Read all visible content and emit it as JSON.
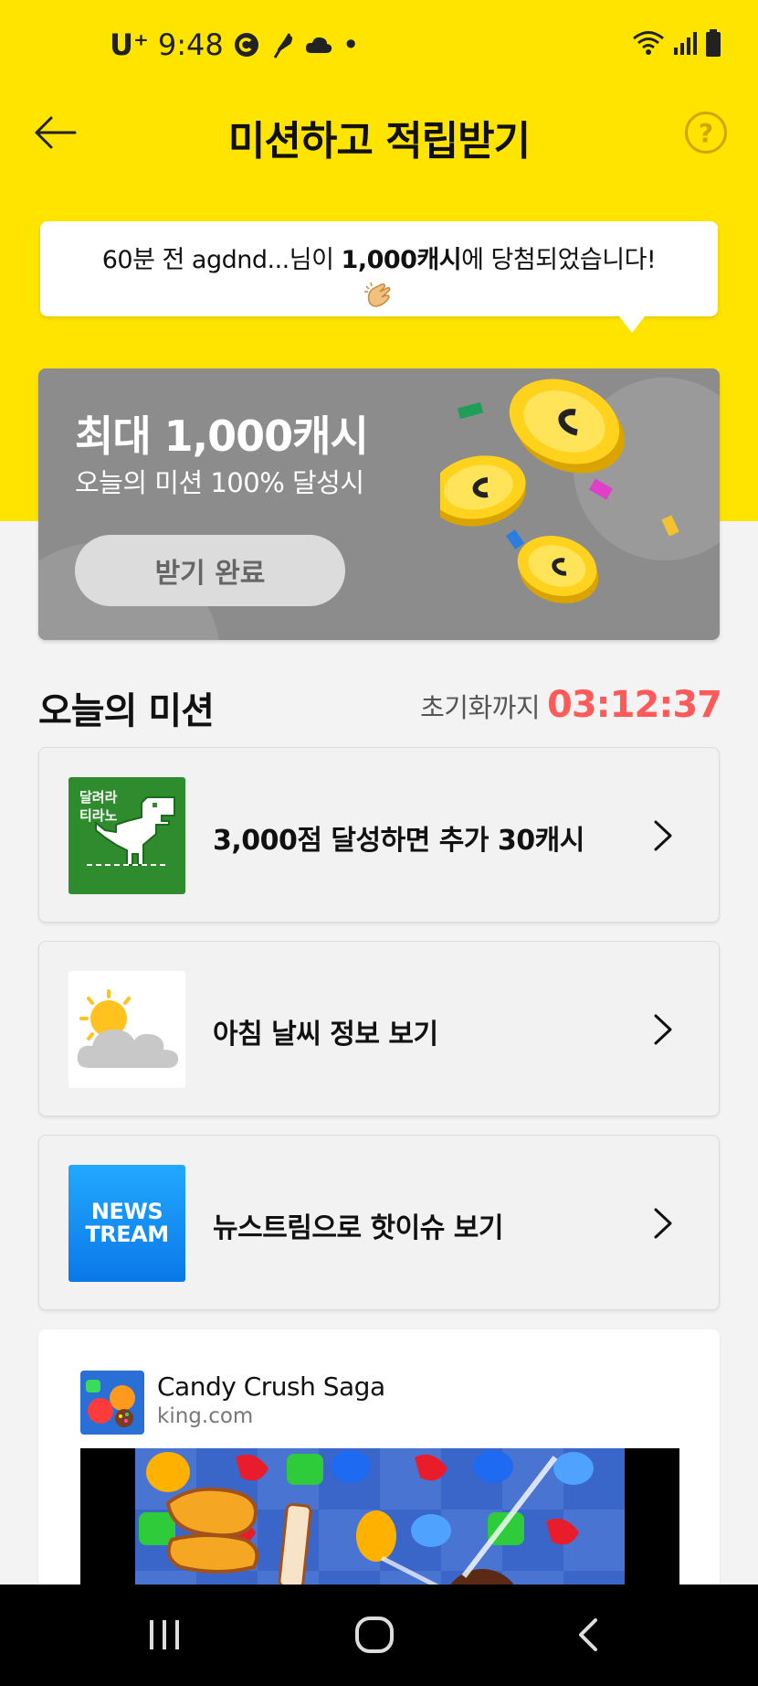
{
  "status_bar": {
    "carrier": "U⁺",
    "time": "9:48",
    "dot": "•"
  },
  "header": {
    "title": "미션하고 적립받기",
    "help": "?"
  },
  "notice": {
    "prefix": "60분 전 agdnd...님이 ",
    "amount": "1,000캐시",
    "suffix": "에 당첨되었습니다!"
  },
  "banner": {
    "title": "최대 1,000캐시",
    "subtitle": "오늘의 미션 100% 달성시",
    "button": "받기 완료"
  },
  "missions_section": {
    "title": "오늘의 미션",
    "reset_label": "초기화까지",
    "timer": "03:12:37"
  },
  "missions": [
    {
      "label": "3,000점 달성하면 추가 30캐시",
      "thumb_line1": "달려라",
      "thumb_line2": "티라노"
    },
    {
      "label": "아침 날씨 정보 보기"
    },
    {
      "label": "뉴스트림으로 핫이슈 보기",
      "thumb_line1": "NEWS",
      "thumb_line2": "TREAM"
    }
  ],
  "ad": {
    "name": "Candy Crush Saga",
    "domain": "king.com"
  },
  "colors": {
    "accent_yellow": "#ffe400",
    "timer_red": "#ff5a5a",
    "banner_gray": "#8c8c8c"
  }
}
